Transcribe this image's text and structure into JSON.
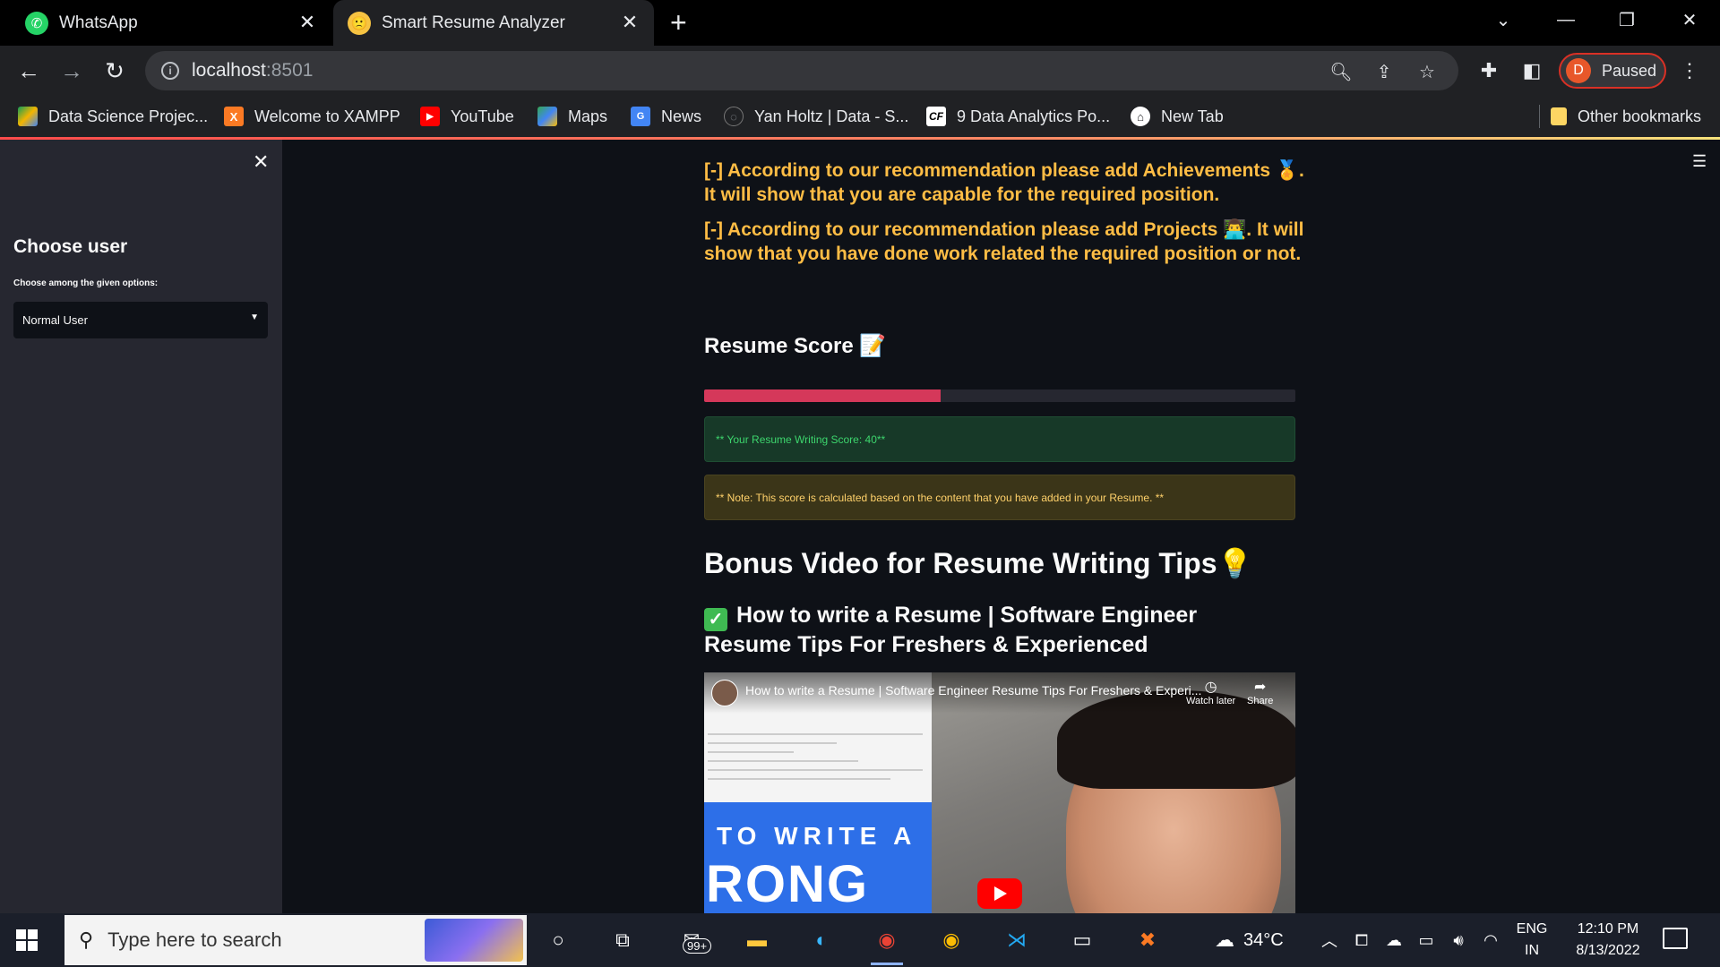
{
  "browser": {
    "tabs": [
      {
        "title": "WhatsApp",
        "icon": "whatsapp-icon"
      },
      {
        "title": "Smart Resume Analyzer",
        "icon": "confused-face-icon",
        "active": true
      }
    ],
    "address": {
      "host": "localhost",
      "port": ":8501"
    },
    "profile": {
      "initial": "D",
      "label": "Paused"
    },
    "bookmarks": [
      {
        "label": "Data Science Projec...",
        "icon": "google-drive-icon"
      },
      {
        "label": "Welcome to XAMPP",
        "icon": "xampp-icon"
      },
      {
        "label": "YouTube",
        "icon": "youtube-icon"
      },
      {
        "label": "Maps",
        "icon": "maps-icon"
      },
      {
        "label": "News",
        "icon": "news-icon"
      },
      {
        "label": "Yan Holtz | Data - S...",
        "icon": "globe-icon"
      },
      {
        "label": "9 Data Analytics Po...",
        "icon": "cf-icon"
      },
      {
        "label": "New Tab",
        "icon": "home-icon"
      }
    ],
    "other_bookmarks": "Other bookmarks"
  },
  "sidebar": {
    "title": "Choose user",
    "select_label": "Choose among the given options:",
    "selected": "Normal User"
  },
  "main": {
    "rec_achievements": "[-] According to our recommendation please add Achievements 🏅. It will show that you are capable for the required position.",
    "rec_projects": "[-] According to our recommendation please add Projects 👨‍💻. It will show that you have done work related the required position or not.",
    "score_heading": "Resume Score 📝",
    "score_progress": 0.4,
    "score_text": "** Your Resume Writing Score: 40**",
    "note_text": "** Note: This score is calculated based on the content that you have added in your Resume. **",
    "bonus_heading": "Bonus Video for Resume Writing Tips💡",
    "video_heading": "How to write a Resume | Software Engineer Resume Tips For Freshers & Experienced",
    "video": {
      "overlay_title": "How to write a Resume | Software Engineer Resume Tips For Freshers & Experi...",
      "watch_later": "Watch later",
      "share": "Share",
      "thumb_line1": "TO WRITE A",
      "thumb_line2": "RONG"
    }
  },
  "taskbar": {
    "search_placeholder": "Type here to search",
    "mail_badge": "99+",
    "weather": "34°C",
    "language": "ENG",
    "region": "IN",
    "time": "12:10 PM",
    "date": "8/13/2022"
  },
  "colors": {
    "accent": "#ff4b4b",
    "recommendation_text": "#ffbd45",
    "progress_fill": "#d5385a",
    "success_text": "#3dd56d",
    "warning_text": "#ffd16a"
  }
}
